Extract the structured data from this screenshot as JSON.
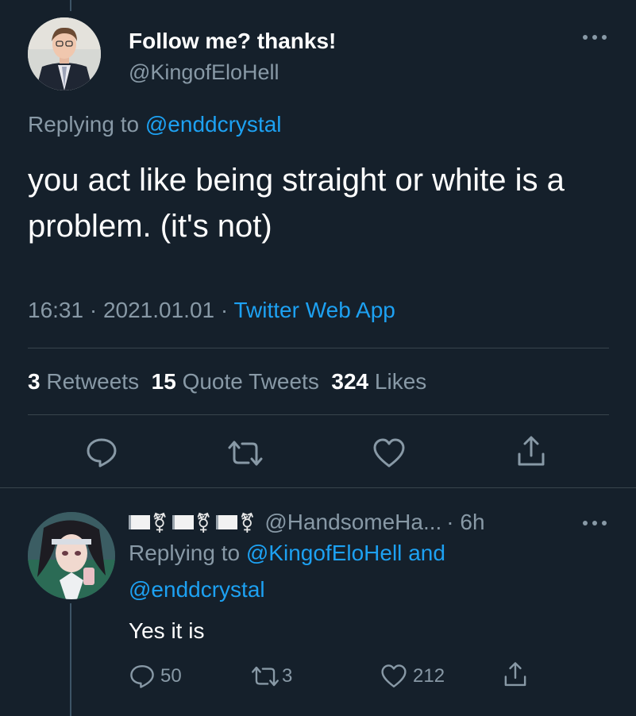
{
  "main_tweet": {
    "author_name": "Follow me? thanks!",
    "handle": "@KingofEloHell",
    "replying_label": "Replying to",
    "replying_handle": "@enddcrystal",
    "text": "you act like being straight or white is a problem. (it's not)",
    "time": "16:31",
    "separator": "·",
    "date": "2021.01.01",
    "source": "Twitter Web App",
    "stats": {
      "retweets_count": "3",
      "retweets_label": "Retweets",
      "quotes_count": "15",
      "quotes_label": "Quote Tweets",
      "likes_count": "324",
      "likes_label": "Likes"
    },
    "actions": [
      "reply-icon",
      "retweet-icon",
      "like-icon",
      "share-icon"
    ]
  },
  "reply_tweet": {
    "display_name_icons": [
      "white-flag",
      "transgender-symbol",
      "white-flag",
      "transgender-symbol",
      "white-flag",
      "transgender-symbol"
    ],
    "flag_glyph": "",
    "trans_glyph": "⚧",
    "handle": "@HandsomeHa...",
    "time": "· 6h",
    "replying_label": "Replying to",
    "replying_handle_1": "@KingofEloHell",
    "replying_and": "and",
    "replying_handle_2": "@enddcrystal",
    "text": "Yes it is",
    "counts": {
      "replies": "50",
      "retweets": "3",
      "likes": "212"
    }
  },
  "colors": {
    "background": "#15202b",
    "text": "#ffffff",
    "secondary": "#8899a6",
    "link": "#1da1f2",
    "divider": "#38444d"
  }
}
